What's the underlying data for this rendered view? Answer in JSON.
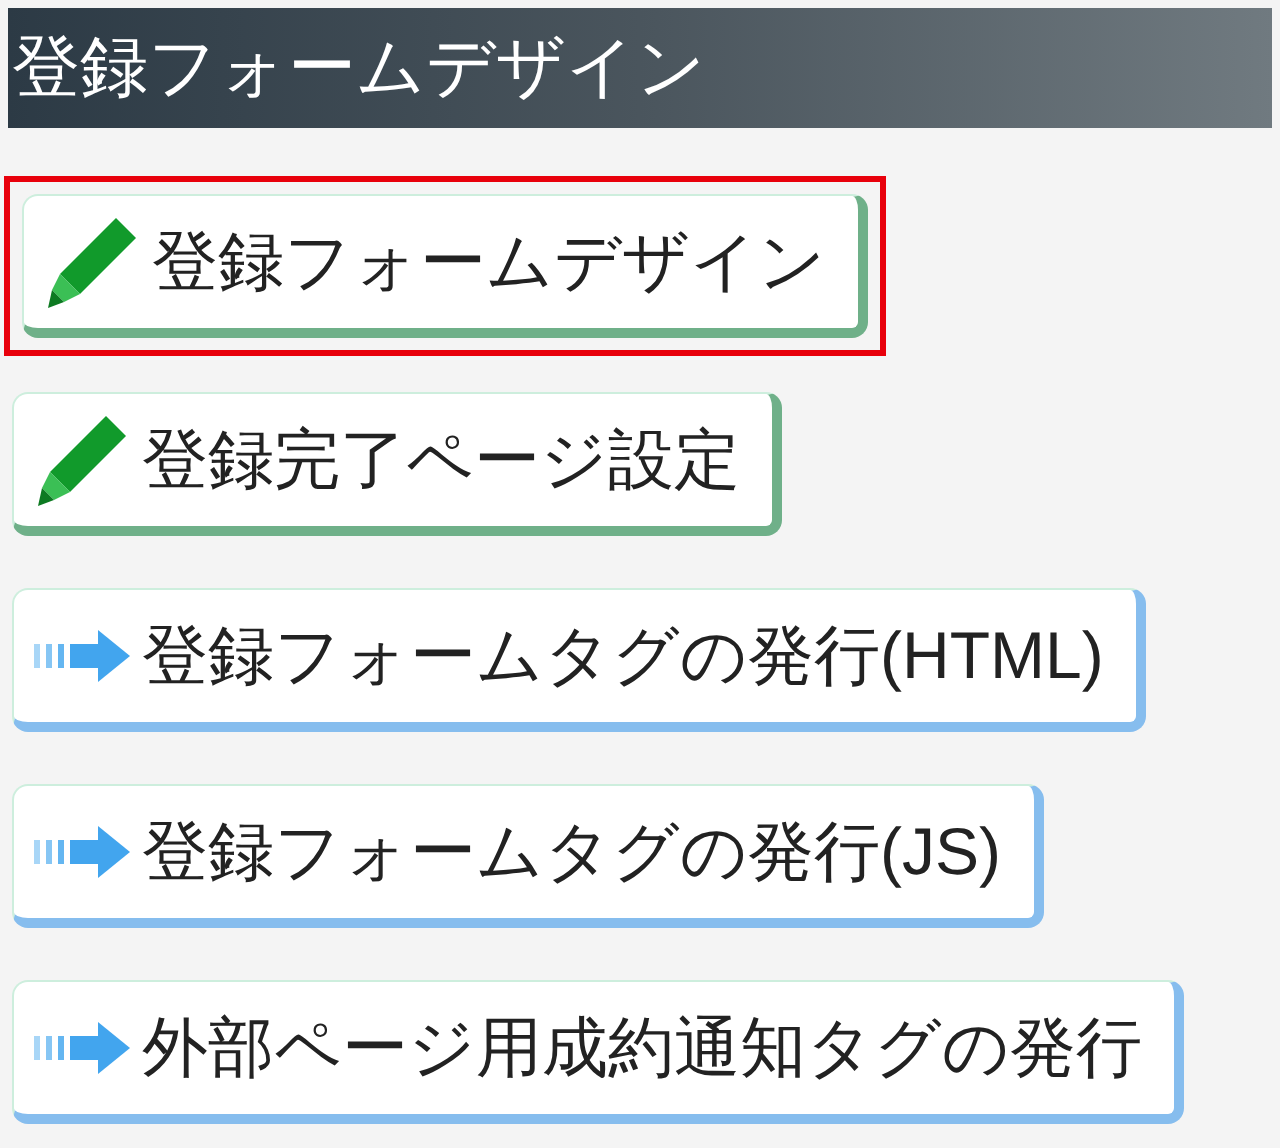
{
  "header": {
    "title": "登録フォームデザイン"
  },
  "menu": [
    {
      "kind": "edit",
      "label": "登録フォームデザイン",
      "selected": true
    },
    {
      "kind": "edit",
      "label": "登録完了ページ設定",
      "selected": false
    },
    {
      "kind": "arrow",
      "label": "登録フォームタグの発行(HTML)",
      "selected": false
    },
    {
      "kind": "arrow",
      "label": "登録フォームタグの発行(JS)",
      "selected": false
    },
    {
      "kind": "arrow",
      "label": "外部ページ用成約通知タグの発行",
      "selected": false
    }
  ]
}
